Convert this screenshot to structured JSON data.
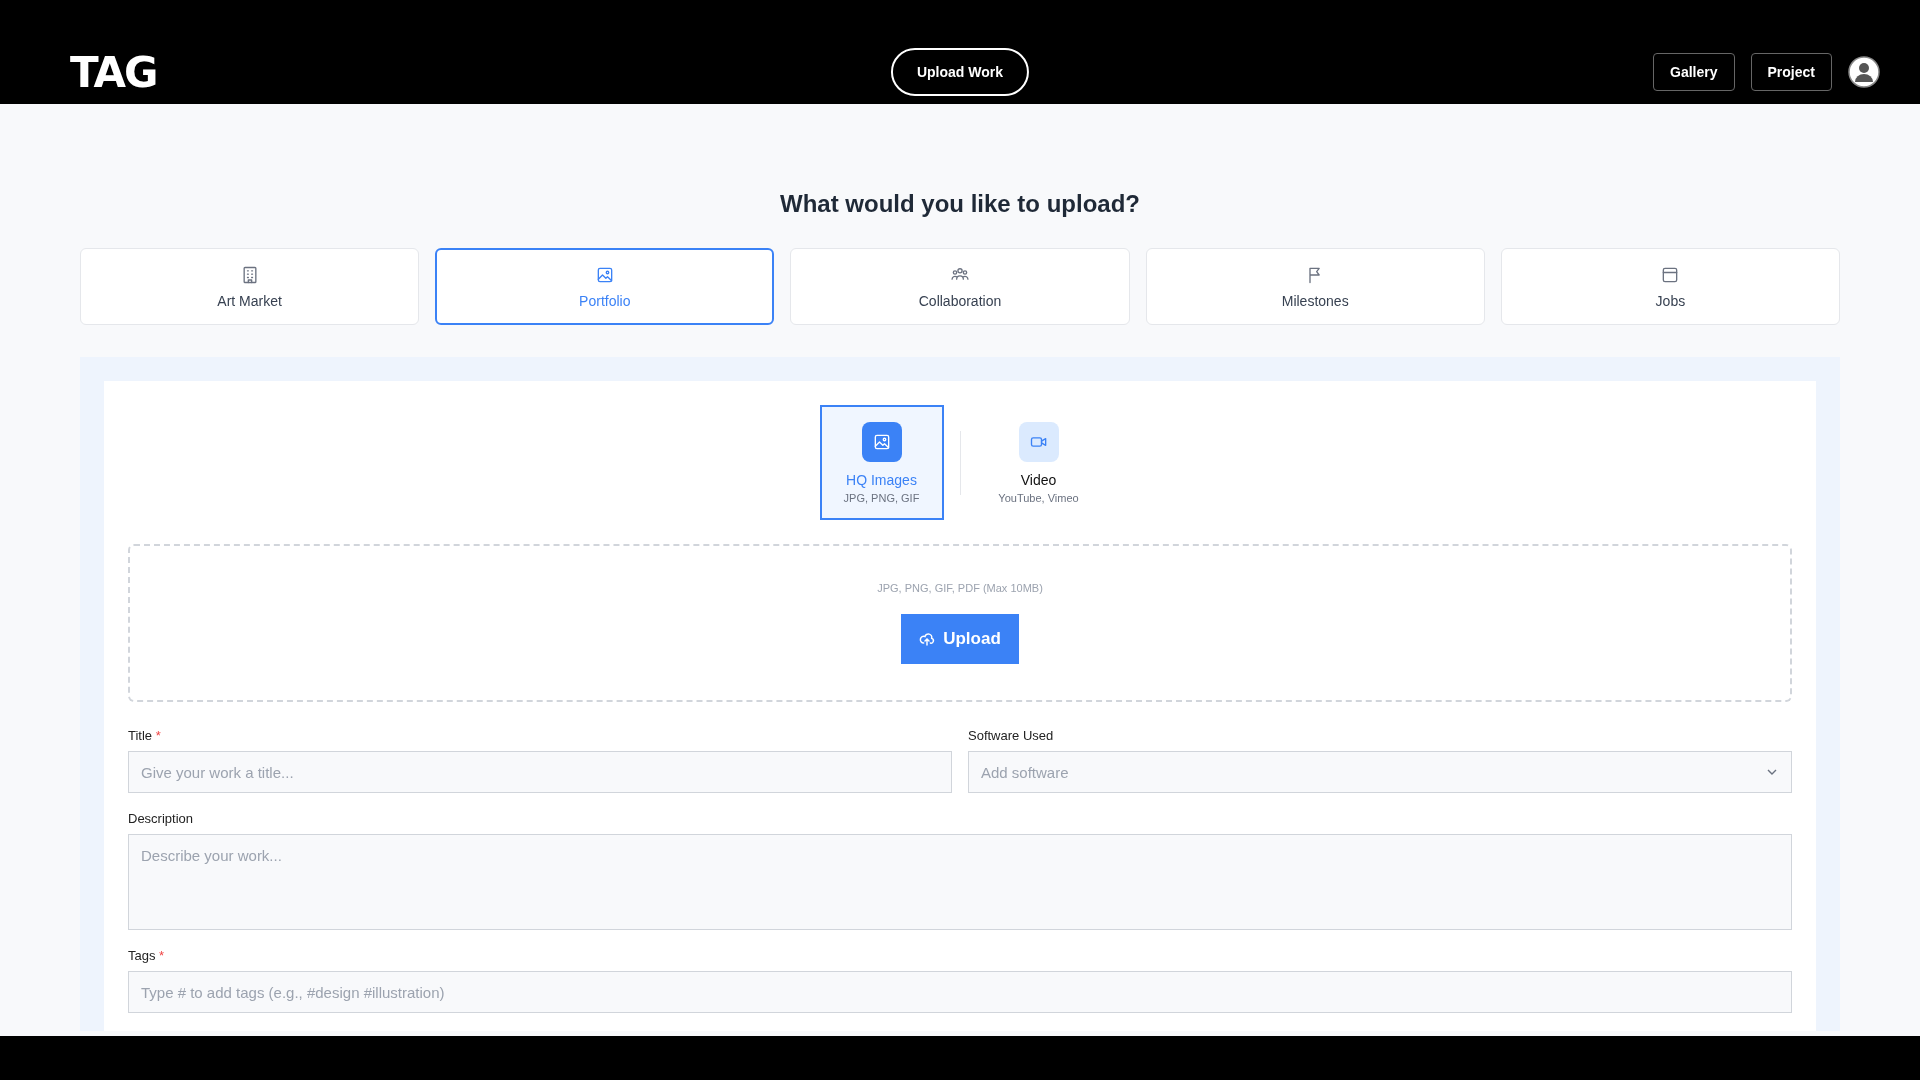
{
  "header": {
    "logo": "TAG",
    "upload_button": "Upload Work",
    "nav_buttons": [
      "Gallery",
      "Project"
    ]
  },
  "heading": "What would you like to upload?",
  "categories": [
    {
      "label": "Art Market",
      "kind": "building",
      "selected": false
    },
    {
      "label": "Portfolio",
      "kind": "image",
      "selected": true
    },
    {
      "label": "Collaboration",
      "kind": "people",
      "selected": false
    },
    {
      "label": "Milestones",
      "kind": "flag",
      "selected": false
    },
    {
      "label": "Jobs",
      "kind": "window",
      "selected": false
    }
  ],
  "media_types": [
    {
      "label": "HQ Images",
      "formats": "JPG, PNG, GIF",
      "kind": "image",
      "selected": true
    },
    {
      "label": "Video",
      "formats": "YouTube, Vimeo",
      "kind": "video",
      "selected": false
    }
  ],
  "dropzone": {
    "hint": "JPG, PNG, GIF, PDF (Max 10MB)",
    "button": "Upload"
  },
  "fields": [
    {
      "kind": "input",
      "label": "Title",
      "required_mark": "*",
      "placeholder": "Give your work a title..."
    },
    {
      "kind": "select",
      "label": "Software Used",
      "placeholder": "Add software"
    },
    {
      "kind": "textarea",
      "label": "Description",
      "placeholder": "Describe your work..."
    },
    {
      "kind": "input",
      "label": "Tags",
      "required_mark": "*",
      "placeholder": "Type # to add tags (e.g., #design #illustration)"
    }
  ]
}
